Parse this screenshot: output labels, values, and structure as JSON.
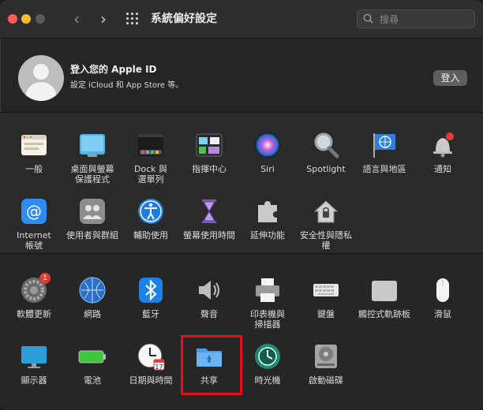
{
  "window": {
    "title": "系統偏好設定"
  },
  "search": {
    "placeholder": "搜尋"
  },
  "account": {
    "title": "登入您的 Apple ID",
    "subtitle": "設定 iCloud 和 App Store 等。",
    "login_label": "登入"
  },
  "section1": [
    {
      "label": "一般",
      "icon": "general-icon"
    },
    {
      "label": "桌面與螢幕\n保護程式",
      "icon": "desktop-icon"
    },
    {
      "label": "Dock 與\n選單列",
      "icon": "dock-icon"
    },
    {
      "label": "指揮中心",
      "icon": "mission-control-icon"
    },
    {
      "label": "Siri",
      "icon": "siri-icon"
    },
    {
      "label": "Spotlight",
      "icon": "spotlight-icon"
    },
    {
      "label": "語言與地區",
      "icon": "language-flag-icon"
    },
    {
      "label": "通知",
      "icon": "bell-icon"
    },
    {
      "label": "Internet\n帳號",
      "icon": "at-icon"
    },
    {
      "label": "使用者與群組",
      "icon": "users-icon"
    },
    {
      "label": "輔助使用",
      "icon": "accessibility-icon"
    },
    {
      "label": "螢幕使用時間",
      "icon": "hourglass-icon"
    },
    {
      "label": "延伸功能",
      "icon": "puzzle-icon"
    },
    {
      "label": "安全性與隱私權",
      "icon": "house-lock-icon"
    }
  ],
  "section2": [
    {
      "label": "軟體更新",
      "icon": "gear-icon",
      "badge": "1"
    },
    {
      "label": "網路",
      "icon": "globe-icon"
    },
    {
      "label": "藍牙",
      "icon": "bluetooth-icon"
    },
    {
      "label": "聲音",
      "icon": "speaker-icon"
    },
    {
      "label": "印表機與\n掃描器",
      "icon": "printer-icon"
    },
    {
      "label": "鍵盤",
      "icon": "keyboard-icon"
    },
    {
      "label": "觸控式軌跡板",
      "icon": "trackpad-icon"
    },
    {
      "label": "滑鼠",
      "icon": "mouse-icon"
    },
    {
      "label": "顯示器",
      "icon": "display-icon"
    },
    {
      "label": "電池",
      "icon": "battery-icon"
    },
    {
      "label": "日期與時間",
      "icon": "clock-icon"
    },
    {
      "label": "共享",
      "icon": "sharing-folder-icon"
    },
    {
      "label": "時光機",
      "icon": "time-machine-icon"
    },
    {
      "label": "啟動磁碟",
      "icon": "disk-icon"
    }
  ],
  "highlighted_item": "共享"
}
